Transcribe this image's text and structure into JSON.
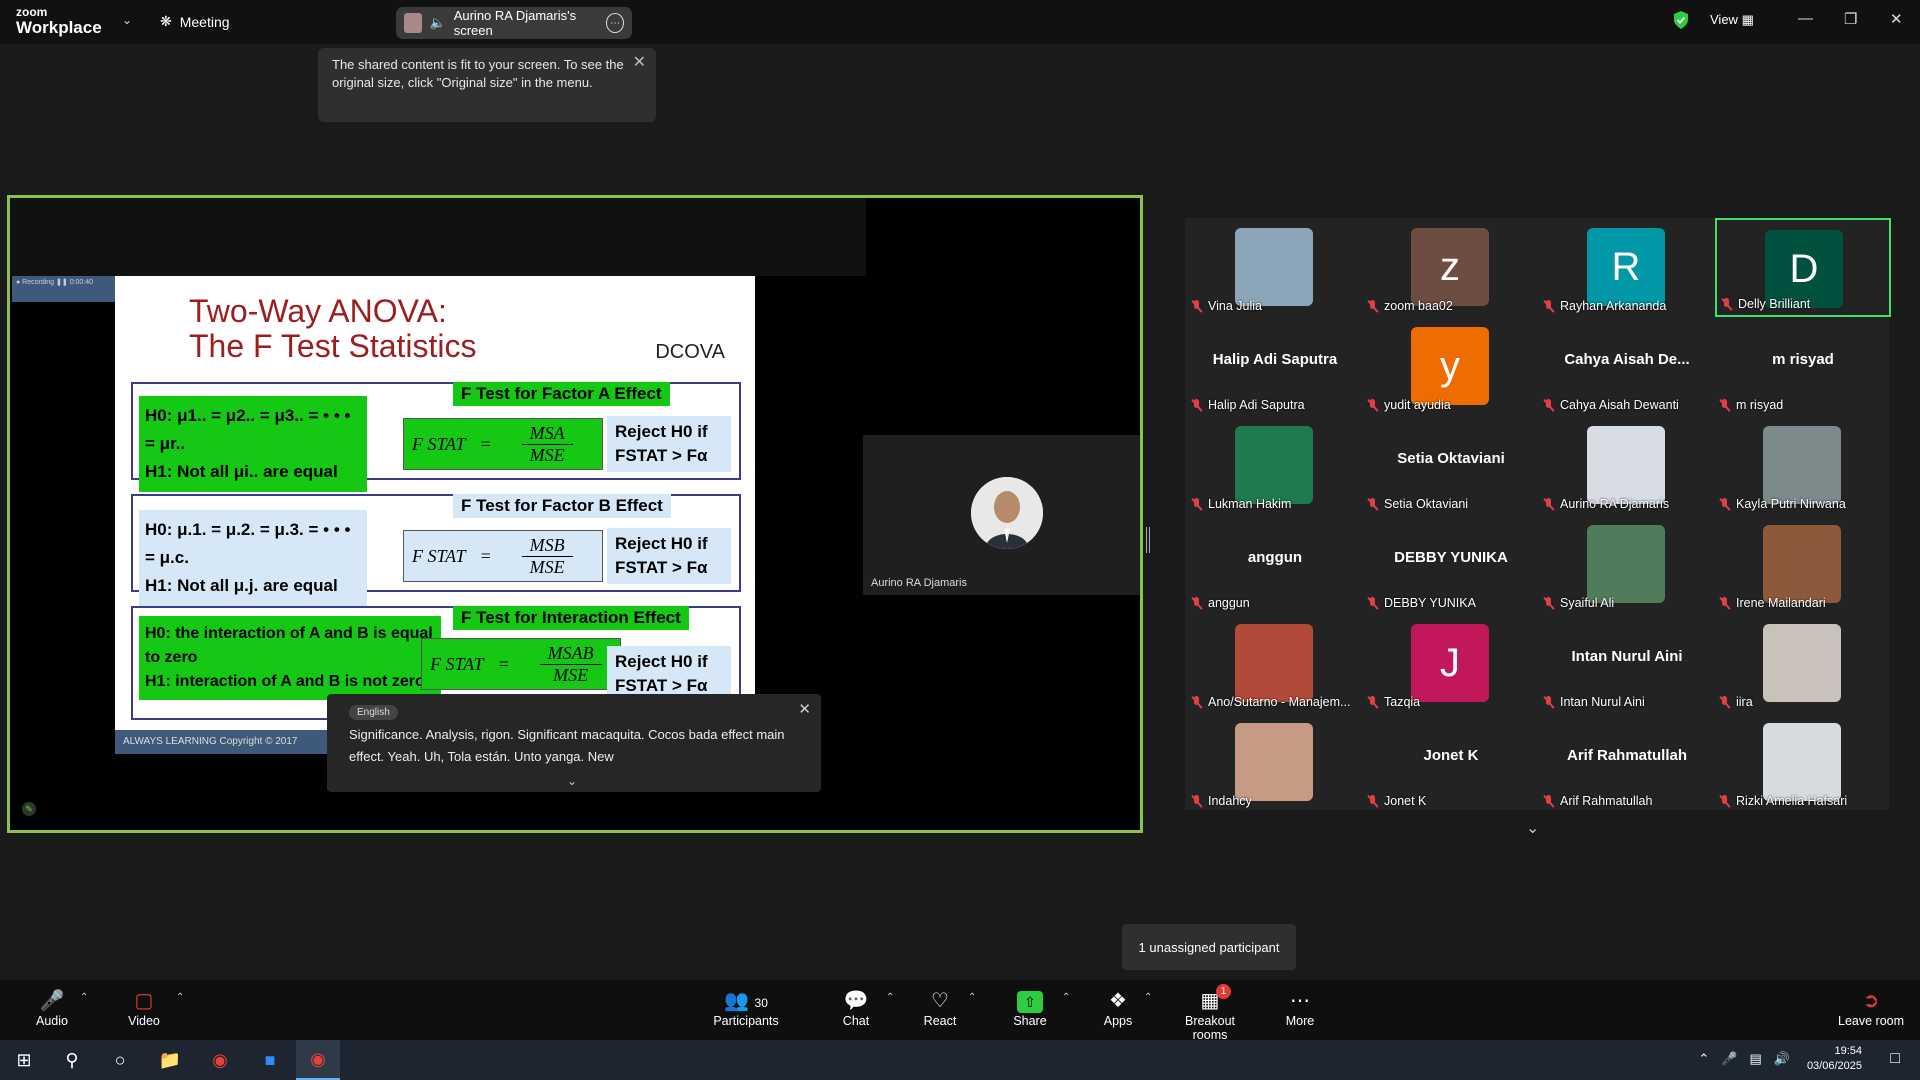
{
  "titlebar": {
    "logo_line1": "zoom",
    "logo_line2": "Workplace",
    "meeting_label": "Meeting",
    "screen_share_label": "Aurino RA Djamaris's screen",
    "view_label": "View"
  },
  "fit_tip": {
    "text": "The shared content is fit to your screen. To see the original size, click \"Original size\" in the menu."
  },
  "slide": {
    "title_line1": "Two-Way ANOVA:",
    "title_line2": "The F Test Statistics",
    "dcova": "DCOVA",
    "a_effect": "F Test for Factor A Effect",
    "a_h0": "H0: μ1.. = μ2.. = μ3.. = • • • = μr..",
    "a_h1": "H1: Not all μi.. are equal",
    "a_num": "MSA",
    "a_den": "MSE",
    "b_effect": "F Test for Factor B Effect",
    "b_h0": "H0: μ.1. = μ.2. = μ.3. = • • • = μ.c.",
    "b_h1": "H1: Not all μ.j. are equal",
    "b_num": "MSB",
    "b_den": "MSE",
    "ab_effect": "F Test for Interaction Effect",
    "ab_h0": "H0: the interaction of A and B is equal to zero",
    "ab_h1": "H1: interaction of A and B is not zero",
    "ab_num": "MSAB",
    "ab_den": "MSE",
    "fstat": "F STAT",
    "reject_line1": "Reject H0 if",
    "reject_line2": "FSTAT > Fα",
    "footer": "ALWAYS LEARNING     Copyright © 2017"
  },
  "presenter": {
    "name": "Aurino RA Djamaris"
  },
  "caption": {
    "language": "English",
    "text": "Significance. Analysis, rigon. Significant macaquita. Cocos bada effect main effect. Yeah. Uh, Tola están. Unto yanga. New"
  },
  "gallery": [
    {
      "name": "Vina Julia",
      "avatar_text": "",
      "color": "#8aa6b8",
      "kind": "photo"
    },
    {
      "name": "zoom baa02",
      "avatar_text": "z",
      "color": "#6d4c41",
      "kind": "letter"
    },
    {
      "name": "Rayhan Arkananda",
      "avatar_text": "R",
      "color": "#0097a7",
      "kind": "letter"
    },
    {
      "name": "Delly Brilliant",
      "avatar_text": "D",
      "color": "#00513f",
      "kind": "letter"
    },
    {
      "name": "Halip Adi Saputra",
      "avatar_text": "Halip Adi Saputra",
      "color": "",
      "kind": "text"
    },
    {
      "name": "yudit ayudia",
      "avatar_text": "y",
      "color": "#ef6c00",
      "kind": "letter"
    },
    {
      "name": "Cahya Aisah Dewanti",
      "avatar_text": "Cahya Aisah De...",
      "color": "",
      "kind": "text"
    },
    {
      "name": "m risyad",
      "avatar_text": "m risyad",
      "color": "",
      "kind": "text"
    },
    {
      "name": "Lukman Hakim",
      "avatar_text": "",
      "color": "#1f7a4f",
      "kind": "photo"
    },
    {
      "name": "Setia Oktaviani",
      "avatar_text": "Setia Oktaviani",
      "color": "",
      "kind": "text"
    },
    {
      "name": "Aurino RA Djamaris",
      "avatar_text": "",
      "color": "#d8dde3",
      "kind": "photo"
    },
    {
      "name": "Kayla Putri Nirwana",
      "avatar_text": "",
      "color": "#7d8a8c",
      "kind": "photo"
    },
    {
      "name": "anggun",
      "avatar_text": "anggun",
      "color": "",
      "kind": "text"
    },
    {
      "name": "DEBBY YUNIKA",
      "avatar_text": "DEBBY YUNIKA",
      "color": "",
      "kind": "text"
    },
    {
      "name": "Syaiful Ali",
      "avatar_text": "",
      "color": "#4f7d5c",
      "kind": "photo"
    },
    {
      "name": "Irene Mailandari",
      "avatar_text": "",
      "color": "#8c5a3a",
      "kind": "photo"
    },
    {
      "name": "Ano/Sutarno - Manajem...",
      "avatar_text": "",
      "color": "#b24a3a",
      "kind": "photo"
    },
    {
      "name": "Tazqia",
      "avatar_text": "J",
      "color": "#c2185b",
      "kind": "letter"
    },
    {
      "name": "Intan Nurul Aini",
      "avatar_text": "Intan Nurul Aini",
      "color": "",
      "kind": "text"
    },
    {
      "name": "iira",
      "avatar_text": "",
      "color": "#c9c2ba",
      "kind": "photo"
    },
    {
      "name": "Indahcy",
      "avatar_text": "",
      "color": "#c79a84",
      "kind": "photo"
    },
    {
      "name": "Jonet K",
      "avatar_text": "Jonet K",
      "color": "",
      "kind": "text"
    },
    {
      "name": "Arif Rahmatullah",
      "avatar_text": "Arif Rahmatullah",
      "color": "",
      "kind": "text"
    },
    {
      "name": "Rizki Amelia Hafsari",
      "avatar_text": "",
      "color": "#d7dbe0",
      "kind": "photo"
    }
  ],
  "active_speaker_index": 3,
  "unassigned": "1 unassigned participant",
  "toolbar": {
    "audio": "Audio",
    "video": "Video",
    "participants": "Participants",
    "participants_count": "30",
    "chat": "Chat",
    "react": "React",
    "share": "Share",
    "apps": "Apps",
    "breakout": "Breakout rooms",
    "breakout_badge": "1",
    "more": "More",
    "leave": "Leave room"
  },
  "taskbar": {
    "time": "19:54",
    "date": "03/06/2025"
  }
}
